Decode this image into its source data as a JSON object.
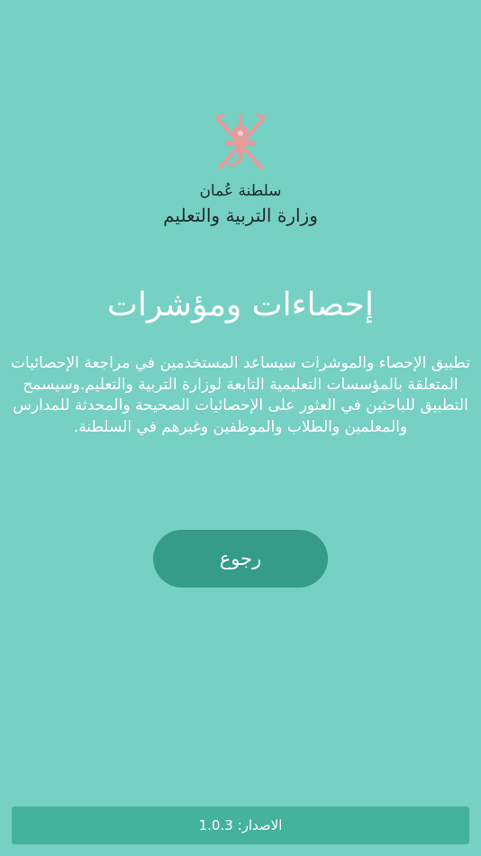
{
  "header": {
    "emblem_icon": "oman-emblem-icon",
    "ministry_line1": "سلطنة عُمان",
    "ministry_line2": "وزارة التربية والتعليم"
  },
  "main": {
    "title": "إحصاءات ومؤشرات",
    "description": "تطبيق الإحصاء والموشرات سيساعد المستخدمين في مراجعة الإحصائيات المتعلقة بالمؤسسات التعليمية التابعة لوزارة التربية والتعليم.وسيسمح التطبيق للباحثين في العثور على الإحصائيات الصحيحة والمحدثة للمدارس والمعلمين والطلاب والموظفين وغيرهم في السلطنة.",
    "back_label": "رجوع"
  },
  "footer": {
    "version_label": "الاصدار: 1.0.3"
  },
  "colors": {
    "background": "#76d0c3",
    "button": "#349c89",
    "footer": "#45b29e",
    "emblem": "#e89a9a"
  }
}
